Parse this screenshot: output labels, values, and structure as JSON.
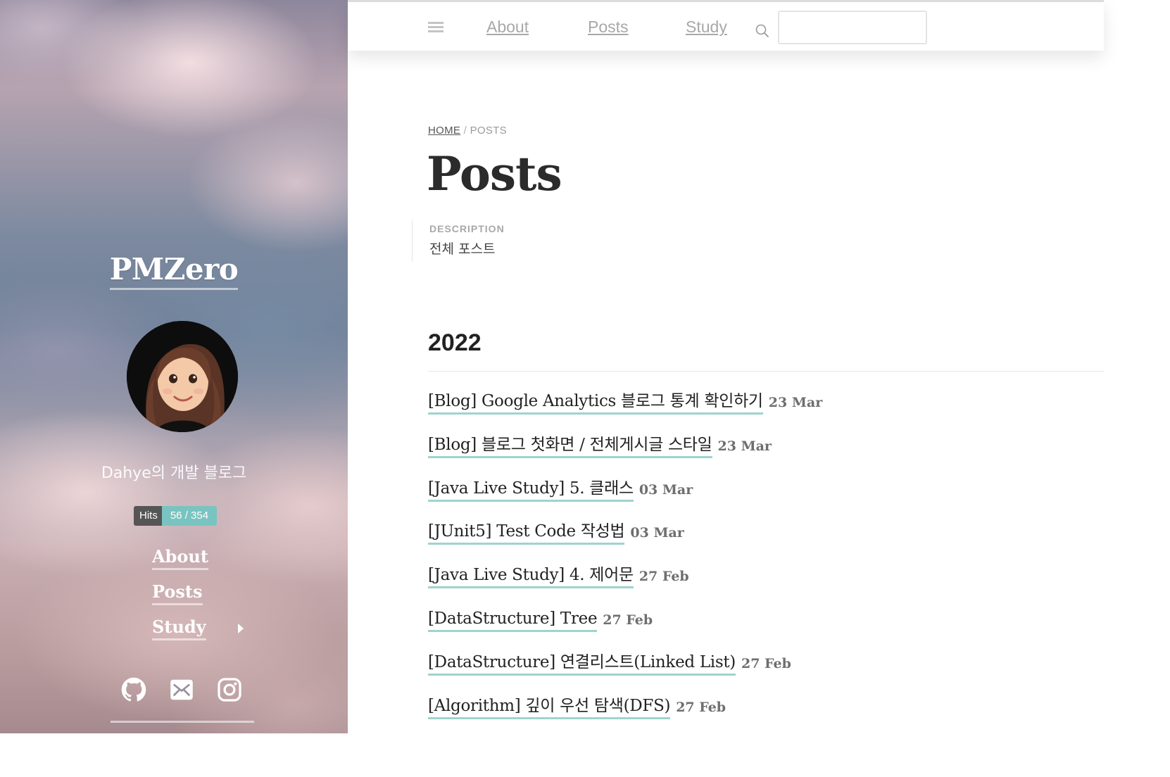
{
  "sidebar": {
    "blog_name": "PMZero",
    "tagline": "Dahye의 개발 블로그",
    "hits": {
      "label": "Hits",
      "value": "56 / 354"
    },
    "nav": [
      {
        "label": "About"
      },
      {
        "label": "Posts"
      },
      {
        "label": "Study",
        "has_submenu": true
      }
    ],
    "social_icons": [
      "github-icon",
      "mail-icon",
      "instagram-icon"
    ]
  },
  "topbar": {
    "menu_icon": "hamburger-icon",
    "links": [
      "About",
      "Posts",
      "Study"
    ],
    "search_icon": "search-icon",
    "search_value": ""
  },
  "breadcrumb": {
    "home": "HOME",
    "separator": "/",
    "current": "POSTS"
  },
  "page": {
    "title": "Posts",
    "description_label": "DESCRIPTION",
    "description": "전체 포스트"
  },
  "archive": {
    "year": "2022",
    "posts": [
      {
        "title": "[Blog] Google Analytics 블로그 통계 확인하기",
        "date": "23 Mar"
      },
      {
        "title": "[Blog] 블로그 첫화면 / 전체게시글 스타일",
        "date": "23 Mar"
      },
      {
        "title": "[Java Live Study] 5. 클래스",
        "date": "03 Mar"
      },
      {
        "title": "[JUnit5] Test Code 작성법",
        "date": "03 Mar"
      },
      {
        "title": "[Java Live Study] 4. 제어문",
        "date": "27 Feb"
      },
      {
        "title": "[DataStructure] Tree",
        "date": "27 Feb"
      },
      {
        "title": "[DataStructure] 연결리스트(Linked List)",
        "date": "27 Feb"
      },
      {
        "title": "[Algorithm] 깊이 우선 탐색(DFS)",
        "date": "27 Feb"
      }
    ]
  },
  "colors": {
    "link_underline": "#9fd3cf",
    "hits_value_bg": "#79c4c0",
    "hits_label_bg": "#555555",
    "title_text": "#2b2b2b"
  }
}
